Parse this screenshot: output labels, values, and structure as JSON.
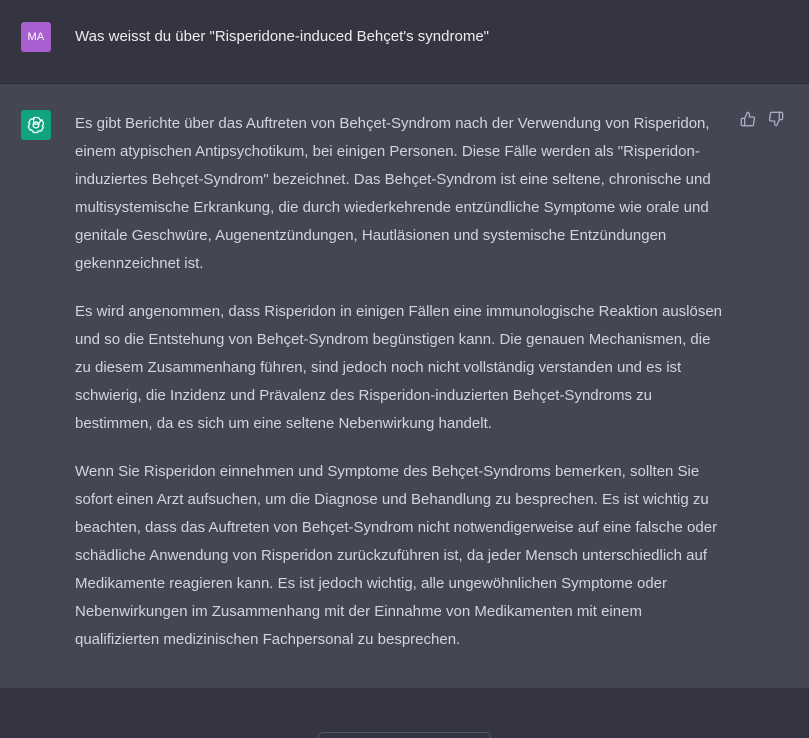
{
  "user_message": {
    "avatar_initials": "MA",
    "text": "Was weisst du über \"Risperidone-induced Behçet's syndrome\""
  },
  "assistant_message": {
    "paragraphs": [
      "Es gibt Berichte über das Auftreten von Behçet-Syndrom nach der Verwendung von Risperidon, einem atypischen Antipsychotikum, bei einigen Personen. Diese Fälle werden als \"Risperidon-induziertes Behçet-Syndrom\" bezeichnet. Das Behçet-Syndrom ist eine seltene, chronische und multisystemische Erkrankung, die durch wiederkehrende entzündliche Symptome wie orale und genitale Geschwüre, Augenentzündungen, Hautläsionen und systemische Entzündungen gekennzeichnet ist.",
      "Es wird angenommen, dass Risperidon in einigen Fällen eine immunologische Reaktion auslösen und so die Entstehung von Behçet-Syndrom begünstigen kann. Die genauen Mechanismen, die zu diesem Zusammenhang führen, sind jedoch noch nicht vollständig verstanden und es ist schwierig, die Inzidenz und Prävalenz des Risperidon-induzierten Behçet-Syndroms zu bestimmen, da es sich um eine seltene Nebenwirkung handelt.",
      "Wenn Sie Risperidon einnehmen und Symptome des Behçet-Syndroms bemerken, sollten Sie sofort einen Arzt aufsuchen, um die Diagnose und Behandlung zu besprechen. Es ist wichtig zu beachten, dass das Auftreten von Behçet-Syndrom nicht notwendigerweise auf eine falsche oder schädliche Anwendung von Risperidon zurückzuführen ist, da jeder Mensch unterschiedlich auf Medikamente reagieren kann. Es ist jedoch wichtig, alle ungewöhnlichen Symptome oder Nebenwirkungen im Zusammenhang mit der Einnahme von Medikamenten mit einem qualifizierten medizinischen Fachpersonal zu besprechen."
    ]
  },
  "icons": {
    "assistant_avatar": "openai-logo-icon",
    "thumbs_up": "thumbs-up-icon",
    "thumbs_down": "thumbs-down-icon"
  },
  "colors": {
    "user_avatar_bg": "#a85fcf",
    "assistant_avatar_bg": "#10a37f",
    "user_row_bg": "#343541",
    "assistant_row_bg": "#444654",
    "text": "#d1d5db"
  }
}
